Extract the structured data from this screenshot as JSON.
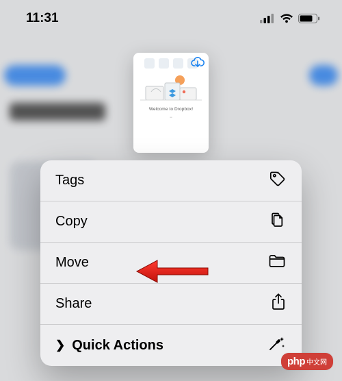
{
  "status": {
    "time": "11:31"
  },
  "thumbnail": {
    "welcome": "Welcome to Dropbox!"
  },
  "menu": {
    "items": [
      {
        "label": "Tags"
      },
      {
        "label": "Copy"
      },
      {
        "label": "Move"
      },
      {
        "label": "Share"
      },
      {
        "label": "Quick Actions"
      }
    ]
  },
  "watermark": {
    "brand": "php",
    "site": "中文网"
  }
}
